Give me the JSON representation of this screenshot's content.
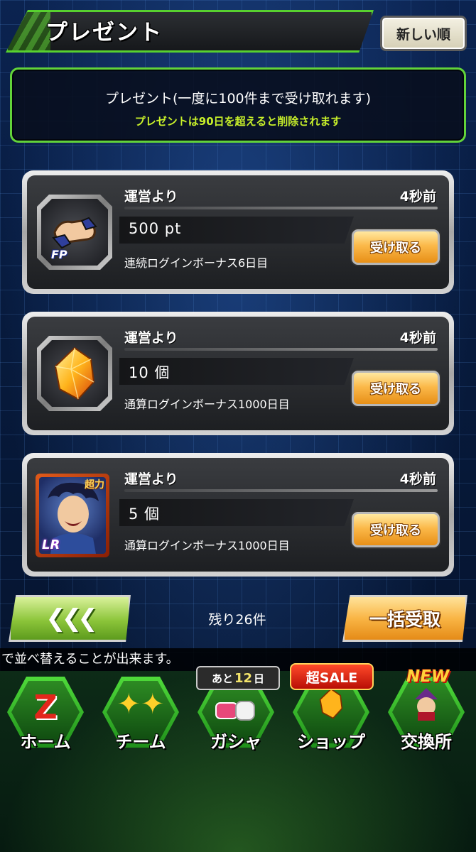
{
  "header": {
    "title": "プレゼント",
    "sort_label": "新しい順"
  },
  "info": {
    "line1": "プレゼント(一度に100件まで受け取れます)",
    "line2": "プレゼントは90日を超えると削除されます"
  },
  "presents": [
    {
      "sender": "運営より",
      "time": "4秒前",
      "amount": "500 pt",
      "description": "連続ログインボーナス6日目",
      "icon": "friendship-points-icon",
      "icon_badge": "FP",
      "button_label": "受け取る"
    },
    {
      "sender": "運営より",
      "time": "4秒前",
      "amount": "10 個",
      "description": "通算ログインボーナス1000日目",
      "icon": "dragon-stone-icon",
      "button_label": "受け取る"
    },
    {
      "sender": "運営より",
      "time": "4秒前",
      "amount": "5 個",
      "description": "通算ログインボーナス1000日目",
      "icon": "character-card-icon",
      "icon_badge": "超力",
      "rarity": "LR",
      "button_label": "受け取る"
    }
  ],
  "footer": {
    "prev_label": "❮❮❮",
    "remaining": "残り26件",
    "bulk_label": "一括受取",
    "ticker": "で並べ替えることが出来ます。"
  },
  "nav": {
    "items": [
      {
        "label": "ホーム",
        "icon": "z-logo-icon"
      },
      {
        "label": "チーム",
        "icon": "team-characters-icon"
      },
      {
        "label": "ガシャ",
        "icon": "capsule-icon"
      },
      {
        "label": "ショップ",
        "icon": "dragon-stone-icon"
      },
      {
        "label": "交換所",
        "icon": "exchange-npc-icon"
      }
    ],
    "gacha_badge_prefix": "あと",
    "gacha_badge_num": "12",
    "gacha_badge_suffix": "日",
    "shop_badge": "超SALE",
    "exchange_badge": "NEW"
  },
  "colors": {
    "accent_green": "#58d12f",
    "note_yellow": "#c8f02a",
    "button_orange": "#f9b545"
  }
}
